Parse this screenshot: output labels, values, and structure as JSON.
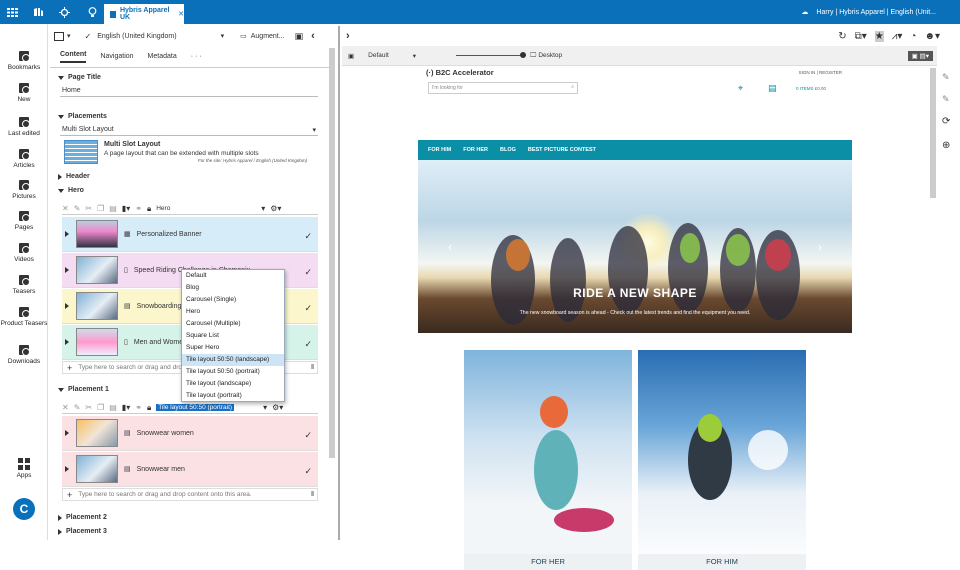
{
  "topbar": {
    "tab": "Hybris Apparel UK",
    "user": "Harry | Hybris Apparel | English (Unit..."
  },
  "nav": [
    "Bookmarks",
    "New",
    "Last edited",
    "Articles",
    "Pictures",
    "Pages",
    "Videos",
    "Teasers",
    "Product Teasers",
    "Downloads",
    "Apps"
  ],
  "left": {
    "language": "English (United Kingdom)",
    "augment": "Augment...",
    "tabs": [
      "Content",
      "Navigation",
      "Metadata",
      "· · ·"
    ],
    "page_title_label": "Page Title",
    "page_title_value": "Home",
    "placements_label": "Placements",
    "layout_value": "Multi Slot Layout",
    "layout_name": "Multi Slot Layout",
    "layout_desc": "A page layout that can be extended with multiple slots",
    "layout_site": "For the site: Hybris Apparel / English (United Kingdom)",
    "header": "Header",
    "hero": "Hero",
    "hero_select": "Hero",
    "hero_items": [
      "Personalized Banner",
      "Speed Riding Challenge in Chamonix",
      "Snowboarding",
      "Men and Women"
    ],
    "add_hint": "Type here to search or drag and drop content onto this area.",
    "placement1": "Placement 1",
    "p1_select": "Tile layout 50:50 (portrait)",
    "p1_items": [
      "Snowwear women",
      "Snowwear men"
    ],
    "placement2": "Placement 2",
    "placement3": "Placement 3",
    "dropdown": [
      "Default",
      "Blog",
      "Carousel (Single)",
      "Hero",
      "Carousel (Multiple)",
      "Square List",
      "Super Hero",
      "Tile layout 50:50 (landscape)",
      "Tile layout 50:50 (portrait)",
      "Tile layout (landscape)",
      "Tile layout (portrait)"
    ]
  },
  "right": {
    "preview": "Default",
    "device": "Desktop",
    "site": "B2C Accelerator",
    "signin": "SIGN IN | REGISTER",
    "search": "I'm looking for",
    "cart": "0 ITEMS £0.00",
    "menu": [
      "FOR HIM",
      "FOR HER",
      "BLOG",
      "BEST PICTURE CONTEST"
    ],
    "hero_title": "RIDE A NEW SHAPE",
    "hero_sub": "The new snowboard season is ahead - Check out the latest trends and find the equipment you need.",
    "tile1": "FOR HER",
    "tile2": "FOR HIM"
  }
}
